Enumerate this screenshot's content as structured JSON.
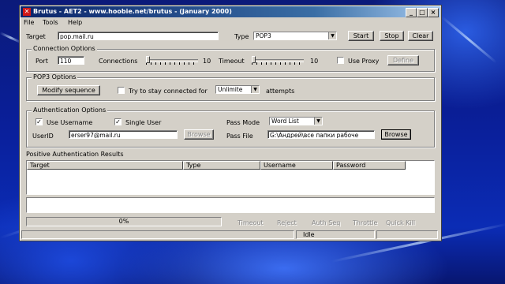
{
  "window": {
    "title": "Brutus - AET2 - www.hoobie.net/brutus - (January 2000)",
    "controls": [
      "_",
      "□",
      "×"
    ]
  },
  "menu": [
    "File",
    "Tools",
    "Help"
  ],
  "target": {
    "label": "Target",
    "value": "pop.mail.ru",
    "type_label": "Type",
    "type_value": "POP3",
    "start": "Start",
    "stop": "Stop",
    "clear": "Clear"
  },
  "connection": {
    "group_title": "Connection Options",
    "port_label": "Port",
    "port_value": "110",
    "connections_label": "Connections",
    "connections_value": 1,
    "connections_max": "10",
    "timeout_label": "Timeout",
    "timeout_value": 1,
    "timeout_max": "10",
    "use_proxy_label": "Use Proxy",
    "use_proxy_checked": false,
    "define": "Define"
  },
  "pop3": {
    "group_title": "POP3 Options",
    "modify_sequence": "Modify sequence",
    "stay_connected_label": "Try to stay connected for",
    "stay_connected_checked": false,
    "attempts_value": "Unlimite",
    "attempts_label": "attempts"
  },
  "auth": {
    "group_title": "Authentication Options",
    "use_username_label": "Use Username",
    "use_username_checked": true,
    "single_user_label": "Single User",
    "single_user_checked": true,
    "userid_label": "UserID",
    "userid_value": "erser97@mail.ru",
    "browse_disabled": "Browse",
    "pass_mode_label": "Pass Mode",
    "pass_mode_value": "Word List",
    "pass_file_label": "Pass File",
    "pass_file_value": "G:\\Андрей\\все папки рабоче",
    "browse": "Browse"
  },
  "results": {
    "title": "Positive Authentication Results",
    "columns": [
      "Target",
      "Type",
      "Username",
      "Password"
    ]
  },
  "progress": {
    "value": 0,
    "text": "0%"
  },
  "disabled_links": [
    "Timeout",
    "Reject",
    "Auth Seq",
    "Throttle",
    "Quick Kill"
  ],
  "status": {
    "text": "Idle"
  }
}
